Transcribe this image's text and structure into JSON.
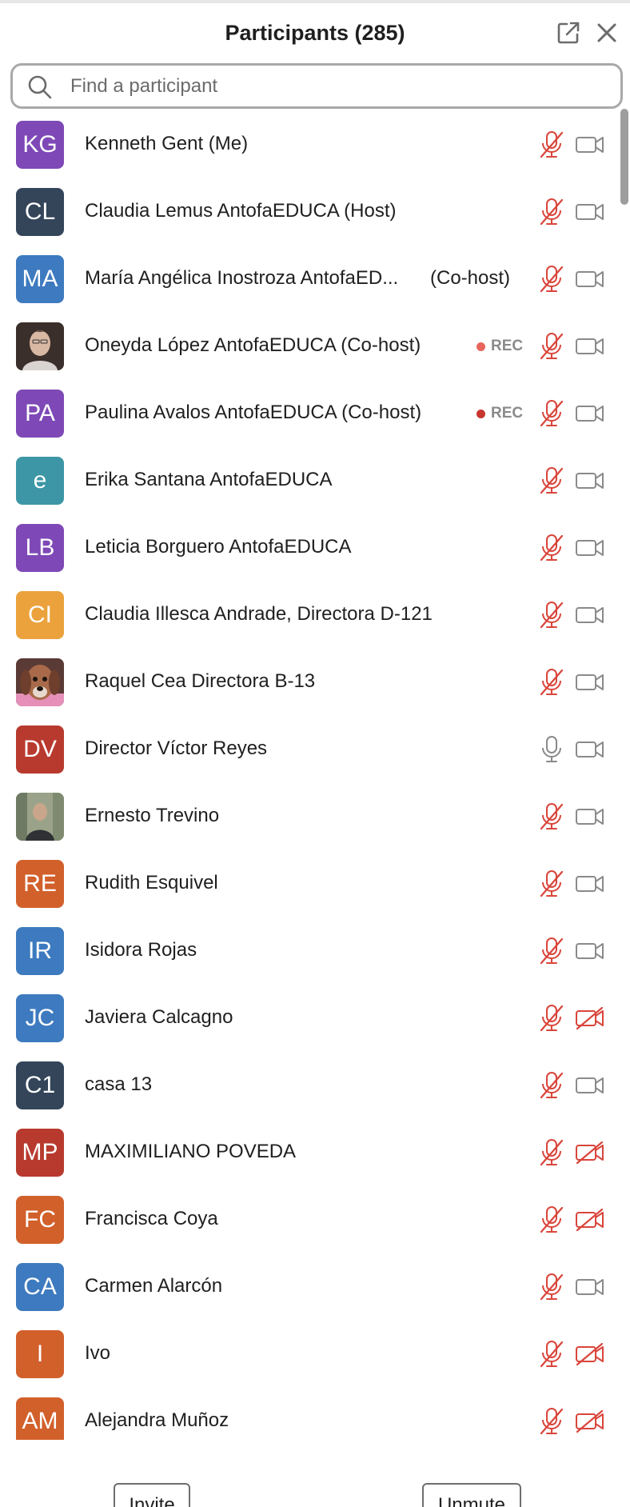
{
  "header": {
    "title": "Participants (285)",
    "popout_icon": "popout-icon",
    "close_icon": "close-icon"
  },
  "search": {
    "placeholder": "Find a participant",
    "value": ""
  },
  "colors": {
    "muted_red": "#d9453b",
    "icon_gray": "#8a8a8a",
    "rec_dot_light": "#e8665d",
    "rec_dot_dark": "#c7362f"
  },
  "participants": [
    {
      "initials": "KG",
      "avatar_color": "#7e49b6",
      "name": "Kenneth Gent (Me)",
      "role": "",
      "rec": "",
      "mic": "muted",
      "video": "on"
    },
    {
      "initials": "CL",
      "avatar_color": "#34455a",
      "name": "Claudia Lemus AntofaEDUCA (Host)",
      "role": "",
      "rec": "",
      "mic": "muted",
      "video": "on"
    },
    {
      "initials": "MA",
      "avatar_color": "#3d7abf",
      "name": "María Angélica Inostroza AntofaED...",
      "role": "(Co-host)",
      "rec": "",
      "mic": "muted",
      "video": "on"
    },
    {
      "initials": "",
      "avatar_color": "#6b5b55",
      "photo": "portrait-woman",
      "name": "Oneyda López AntofaEDUCA (Co-host)",
      "role": "",
      "rec": "REC",
      "rec_dot": "#e8665d",
      "mic": "muted",
      "video": "on"
    },
    {
      "initials": "PA",
      "avatar_color": "#7e49b6",
      "name": "Paulina Avalos AntofaEDUCA (Co-host)",
      "role": "",
      "rec": "REC",
      "rec_dot": "#c7362f",
      "mic": "muted",
      "video": "on"
    },
    {
      "initials": "e",
      "avatar_color": "#3c96a6",
      "name": "Erika Santana AntofaEDUCA",
      "role": "",
      "rec": "",
      "mic": "muted",
      "video": "on"
    },
    {
      "initials": "LB",
      "avatar_color": "#7e49b6",
      "name": "Leticia Borguero AntofaEDUCA",
      "role": "",
      "rec": "",
      "mic": "muted",
      "video": "on"
    },
    {
      "initials": "CI",
      "avatar_color": "#eba23c",
      "name": "Claudia Illesca Andrade, Directora D-121",
      "role": "",
      "rec": "",
      "mic": "muted",
      "video": "on"
    },
    {
      "initials": "",
      "avatar_color": "#a0614a",
      "photo": "dog",
      "name": "Raquel Cea Directora B-13",
      "role": "",
      "rec": "",
      "mic": "muted",
      "video": "on"
    },
    {
      "initials": "DV",
      "avatar_color": "#b83a2e",
      "name": "Director Víctor Reyes",
      "role": "",
      "rec": "",
      "mic": "unmuted",
      "video": "on"
    },
    {
      "initials": "",
      "avatar_color": "#6e7a63",
      "photo": "portrait-man",
      "name": "Ernesto Trevino",
      "role": "",
      "rec": "",
      "mic": "muted",
      "video": "on"
    },
    {
      "initials": "RE",
      "avatar_color": "#d2602b",
      "name": "Rudith Esquivel",
      "role": "",
      "rec": "",
      "mic": "muted",
      "video": "on"
    },
    {
      "initials": "IR",
      "avatar_color": "#3d7abf",
      "name": "Isidora Rojas",
      "role": "",
      "rec": "",
      "mic": "muted",
      "video": "on"
    },
    {
      "initials": "JC",
      "avatar_color": "#3d7abf",
      "name": "Javiera Calcagno",
      "role": "",
      "rec": "",
      "mic": "muted",
      "video": "off"
    },
    {
      "initials": "C1",
      "avatar_color": "#34455a",
      "name": "casa 13",
      "role": "",
      "rec": "",
      "mic": "muted",
      "video": "on"
    },
    {
      "initials": "MP",
      "avatar_color": "#b83a2e",
      "name": "MAXIMILIANO POVEDA",
      "role": "",
      "rec": "",
      "mic": "muted",
      "video": "off"
    },
    {
      "initials": "FC",
      "avatar_color": "#d2602b",
      "name": "Francisca Coya",
      "role": "",
      "rec": "",
      "mic": "muted",
      "video": "off"
    },
    {
      "initials": "CA",
      "avatar_color": "#3d7abf",
      "name": "Carmen Alarcón",
      "role": "",
      "rec": "",
      "mic": "muted",
      "video": "on"
    },
    {
      "initials": "I",
      "avatar_color": "#d2602b",
      "name": "Ivo",
      "role": "",
      "rec": "",
      "mic": "muted",
      "video": "off"
    },
    {
      "initials": "AM",
      "avatar_color": "#d2602b",
      "name": "Alejandra Muñoz",
      "role": "",
      "rec": "",
      "mic": "muted",
      "video": "off"
    }
  ],
  "footer": {
    "invite_label": "Invite",
    "unmute_label": "Unmute"
  }
}
